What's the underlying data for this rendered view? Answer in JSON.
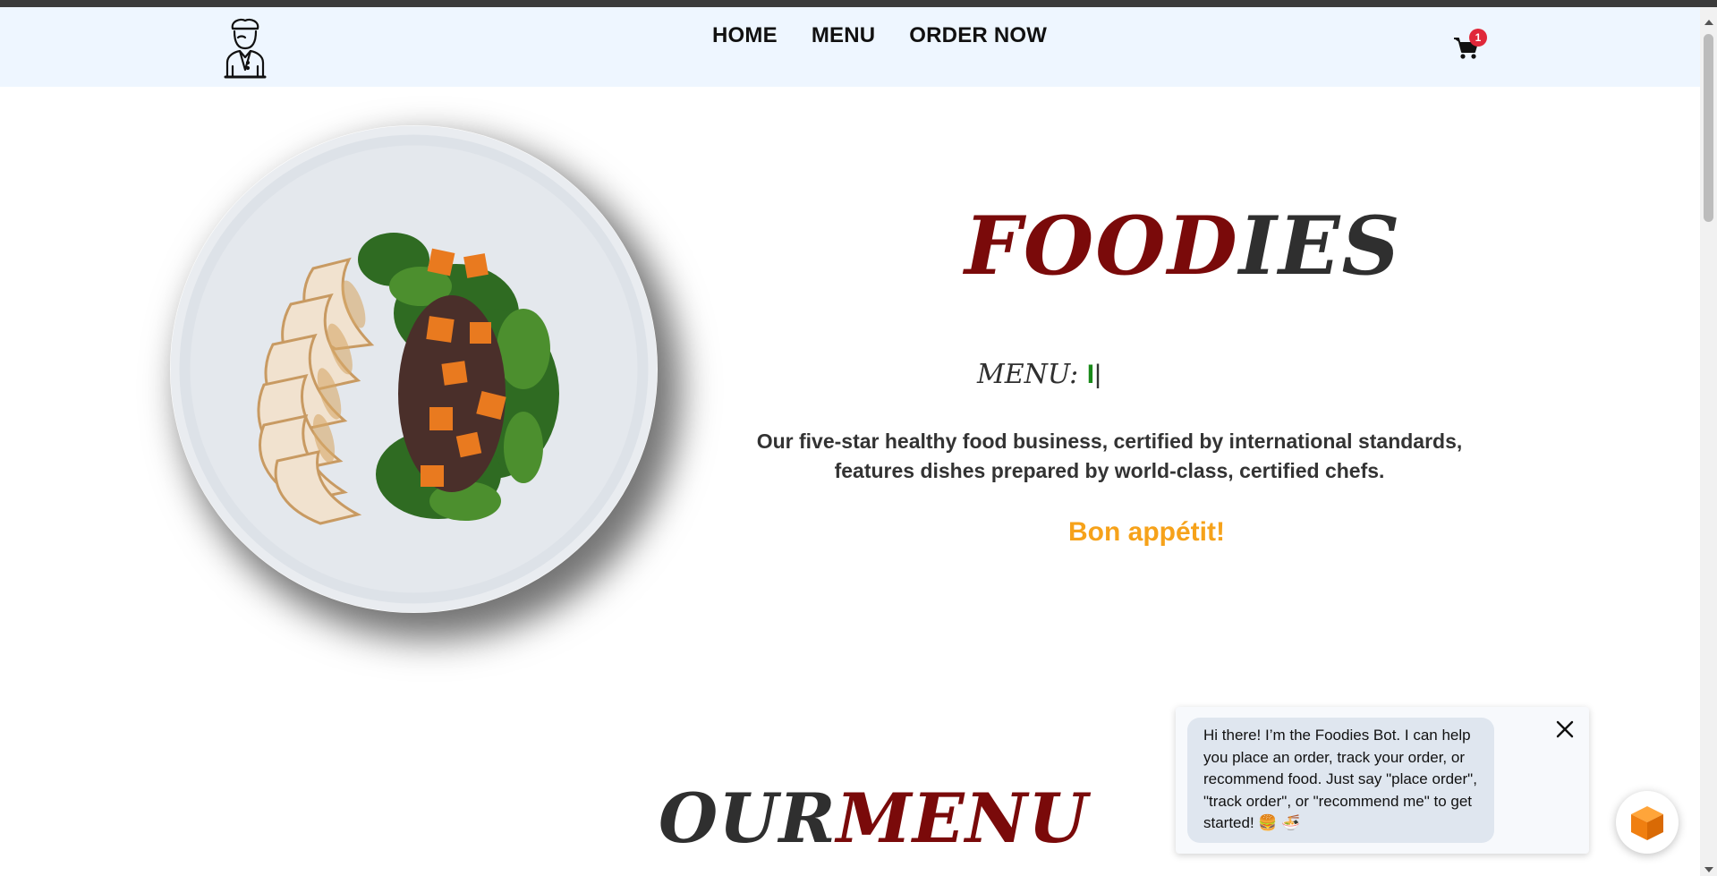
{
  "nav": {
    "logo_icon": "chef-icon",
    "links": [
      {
        "label": "HOME"
      },
      {
        "label": "MENU"
      },
      {
        "label": "ORDER NOW"
      }
    ],
    "cart_icon": "cart-icon",
    "cart_count": "1"
  },
  "hero": {
    "image_icon": "salad-plate-image",
    "brand_part1": "FOOD",
    "brand_part2": "IES",
    "menu_label": "MENU:",
    "menu_typed": "I",
    "menu_cursor": "|",
    "description": "Our five-star healthy food business, certified by international standards, features dishes prepared by world-class, certified chefs.",
    "tagline": "Bon appétit!"
  },
  "section": {
    "title_part1": "OUR",
    "title_part2": "MENU"
  },
  "chatbot": {
    "message": "Hi there! I’m the Foodies Bot. I can help you place an order, track your order, or recommend food. Just say \"place order\", \"track order\", or \"recommend me\" to get started! 🍔 🍜",
    "close_icon": "close-icon",
    "launcher_icon": "cube-icon"
  },
  "colors": {
    "nav_bg": "#eef6ff",
    "brand_red": "#7a0a0a",
    "brand_dark": "#2f2f2f",
    "accent_orange": "#f6a21a",
    "badge_red": "#e0283a",
    "typed_green": "#1a8a1a"
  }
}
